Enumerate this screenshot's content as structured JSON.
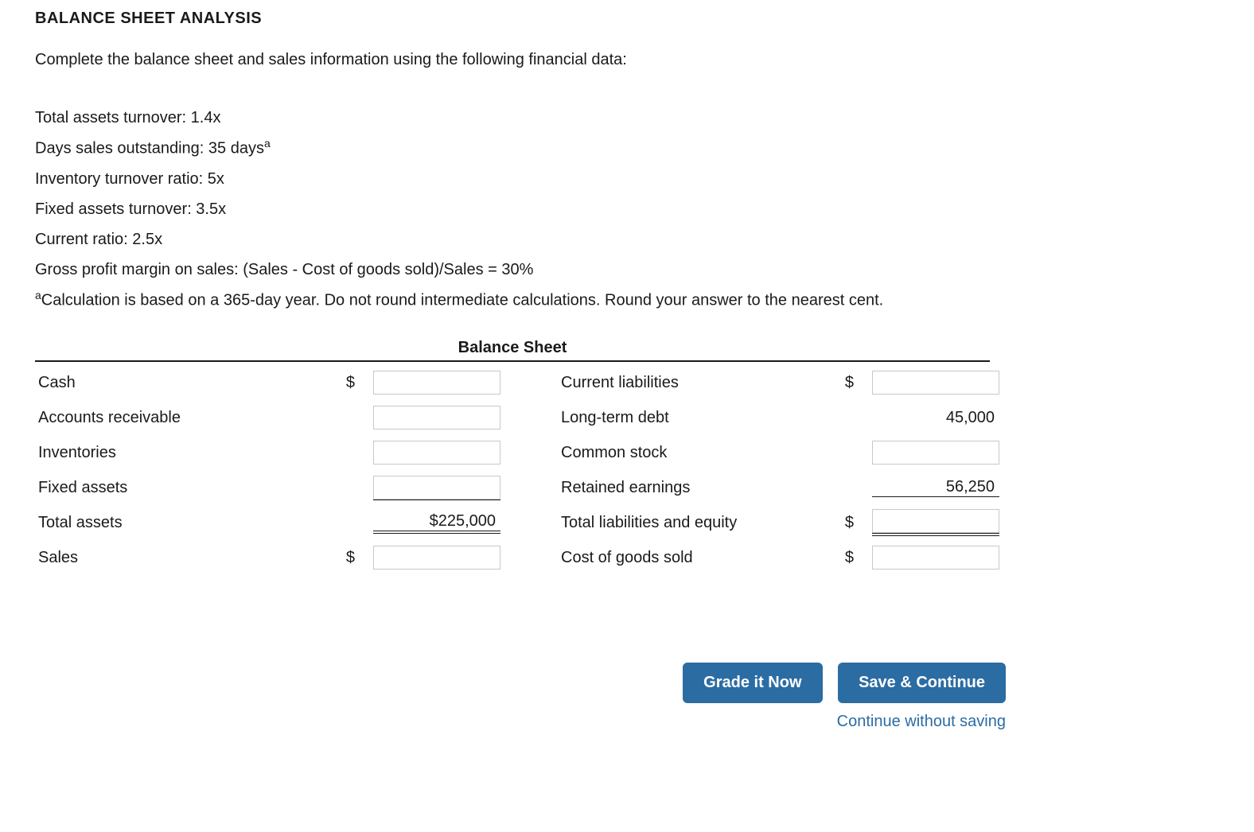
{
  "heading": "BALANCE SHEET ANALYSIS",
  "instruction": "Complete the balance sheet and sales information using the following financial data:",
  "financial_data": [
    "Total assets turnover: 1.4x",
    "Days sales outstanding: 35 days",
    "Inventory turnover ratio: 5x",
    "Fixed assets turnover: 3.5x",
    "Current ratio: 2.5x",
    "Gross profit margin on sales: (Sales - Cost of goods sold)/Sales = 30%"
  ],
  "footnote_marker": "a",
  "footnote": "Calculation is based on a 365-day year. Do not round intermediate calculations. Round your answer to the nearest cent.",
  "table_title": "Balance Sheet",
  "currency_symbol": "$",
  "left_rows": [
    {
      "label": "Cash",
      "type": "input",
      "currency": true
    },
    {
      "label": "Accounts receivable",
      "type": "input",
      "currency": false
    },
    {
      "label": "Inventories",
      "type": "input",
      "currency": false
    },
    {
      "label": "Fixed assets",
      "type": "input",
      "currency": false
    },
    {
      "label": "Total assets",
      "type": "static",
      "currency": false,
      "value": "$225,000",
      "totals": true
    },
    {
      "label": "Sales",
      "type": "input",
      "currency": true
    }
  ],
  "right_rows": [
    {
      "label": "Current liabilities",
      "type": "input",
      "currency": true
    },
    {
      "label": "Long-term debt",
      "type": "static",
      "currency": false,
      "value": "45,000"
    },
    {
      "label": "Common stock",
      "type": "input",
      "currency": false
    },
    {
      "label": "Retained earnings",
      "type": "static",
      "currency": false,
      "value": "56,250"
    },
    {
      "label": "Total liabilities and equity",
      "type": "input",
      "currency": true,
      "totals": true
    },
    {
      "label": "Cost of goods sold",
      "type": "input",
      "currency": true
    }
  ],
  "buttons": {
    "grade": "Grade it Now",
    "save": "Save & Continue",
    "link": "Continue without saving"
  }
}
